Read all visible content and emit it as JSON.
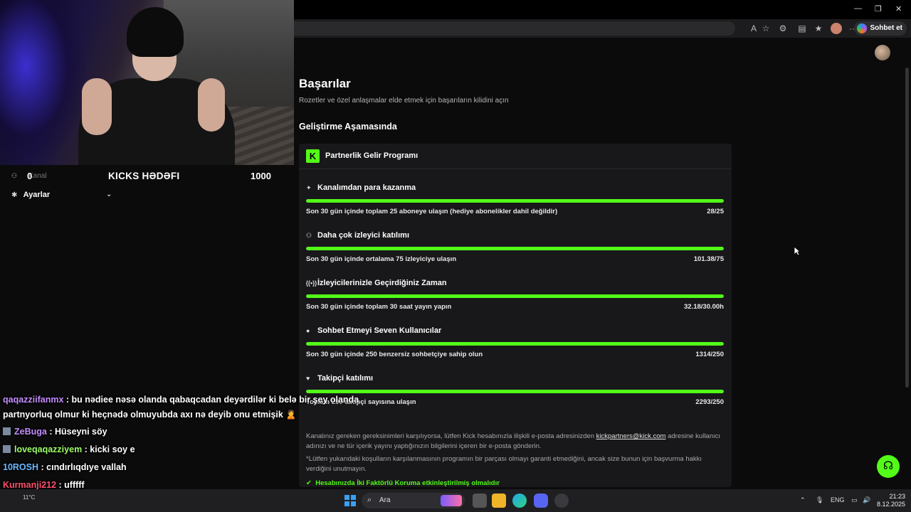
{
  "browser": {
    "copilot_label": "Sohbet et"
  },
  "page": {
    "title": "Başarılar",
    "subtitle": "Rozetler ve özel anlaşmalar elde etmek için başarıların kilidini açın",
    "section": "Geliştirme Aşamasında",
    "program_title": "Partnerlik Gelir Programı",
    "program_logo": "K",
    "items": [
      {
        "icon": "sparkle-icon",
        "glyph": "✦",
        "title": "Kanalımdan para kazanma",
        "desc": "Son 30 gün içinde toplam 25 aboneye ulaşın (hediye abonelikler dahil değildir)",
        "value": "28/25",
        "progress": 1.0
      },
      {
        "icon": "users-icon",
        "glyph": "⚇",
        "title": "Daha çok izleyici katılımı",
        "desc": "Son 30 gün içinde ortalama 75 izleyiciye ulaşın",
        "value": "101.38/75",
        "progress": 1.0
      },
      {
        "icon": "broadcast-icon",
        "glyph": "((•))",
        "title": "İzleyicilerinizle Geçirdiğiniz Zaman",
        "desc": "Son 30 gün içinde toplam 30 saat yayın yapın",
        "value": "32.18/30.00h",
        "progress": 1.0
      },
      {
        "icon": "chat-icon",
        "glyph": "●",
        "title": "Sohbet Etmeyi Seven Kullanıcılar",
        "desc": "Son 30 gün içinde 250 benzersiz sohbetçiye sahip olun",
        "value": "1314/250",
        "progress": 1.0
      },
      {
        "icon": "heart-icon",
        "glyph": "♥",
        "title": "Takipçi katılımı",
        "desc": "Toplam 250 takipçi sayısına ulaşın",
        "value": "2293/250",
        "progress": 1.0
      }
    ],
    "footer1_a": "Kanalınız gereken gereksinimleri karşılıyorsa, lütfen Kick hesabınızla ilişkili e-posta adresinizden ",
    "footer1_link": "kickpartners@kick.com",
    "footer1_b": " adresine kullanıcı adınızı ve ne tür içerik yayını yaptığınızın bilgilerini içeren bir e-posta gönderin.",
    "footer2": "*Lütfen yukarıdaki koşulların karşılanmasının programın bir parçası olmayı garanti etmediğini, ancak size bunun için başvurma hakkı verdiğini unutmayın.",
    "footer3": "Hesabınızda İki Faktörlü Koruma etkinleştirilmiş olmalıdır",
    "accent": "#53fc18"
  },
  "overlay": {
    "goal_current": "0",
    "goal_title": "KICKS HƏDƏFI",
    "goal_target": "1000",
    "goal_faded": "Kanal",
    "settings_label": "Ayarlar"
  },
  "chat": [
    {
      "user": "qaqazziifanmx",
      "color": "#c58cff",
      "text": " : bu nədiee nəsə olanda qabaqcadan deyərdilər ki belə bir şey olanda",
      "badge": false
    },
    {
      "user": "",
      "color": "#ffffff",
      "text": "partnyorluq olmur ki heçnədə olmuyubda axı nə deyib onu etmişik 🙎",
      "badge": false
    },
    {
      "user": "ZeBuga",
      "color": "#c58cff",
      "text": " : Hüseyni söy",
      "badge": true
    },
    {
      "user": "loveqaqazziyem",
      "color": "#9dff6a",
      "text": " : kicki soy e",
      "badge": true
    },
    {
      "user": "10ROSH",
      "color": "#6ab8ff",
      "text": " : cındırlıqdıye vallah",
      "badge": false
    },
    {
      "user": "Kurmanji212",
      "color": "#ff4f6a",
      "text": " : ufffff",
      "badge": false
    },
    {
      "user": "ZeBuga",
      "color": "#c58cff",
      "text": " : Hüseyni söy",
      "badge": true
    }
  ],
  "taskbar": {
    "search_text": "Ara",
    "weather": "11°C",
    "lang": "ENG",
    "time": "21:23",
    "date": "8.12.2025"
  }
}
